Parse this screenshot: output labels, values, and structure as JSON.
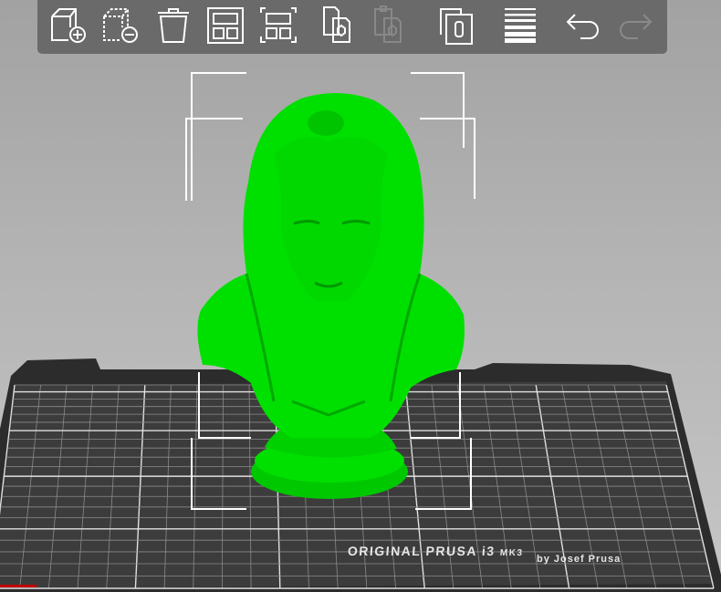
{
  "toolbar": {
    "items": [
      {
        "name": "add",
        "icon": "add-object-icon",
        "enabled": true
      },
      {
        "name": "delete",
        "icon": "delete-object-icon",
        "enabled": true
      },
      {
        "name": "delete-all",
        "icon": "trash-icon",
        "enabled": true
      },
      {
        "name": "arrange",
        "icon": "arrange-icon",
        "enabled": true
      },
      {
        "name": "arrange-selection",
        "icon": "arrange-selection-icon",
        "enabled": true
      },
      {
        "name": "copy",
        "icon": "copy-icon",
        "enabled": true
      },
      {
        "name": "paste",
        "icon": "paste-icon",
        "enabled": false
      },
      {
        "name": "instances",
        "icon": "instances-icon",
        "enabled": true
      },
      {
        "name": "layers",
        "icon": "layers-editing-icon",
        "enabled": true
      },
      {
        "name": "undo",
        "icon": "undo-icon",
        "enabled": true
      },
      {
        "name": "redo",
        "icon": "redo-icon",
        "enabled": false
      }
    ]
  },
  "bed": {
    "title": "ORIGINAL PRUSA i3",
    "model": "MK3",
    "subtitle": "by Josef Prusa"
  },
  "colors": {
    "model": "#00e000",
    "bed": "#3a3a3a",
    "toolbar": "#6a6a6a"
  }
}
